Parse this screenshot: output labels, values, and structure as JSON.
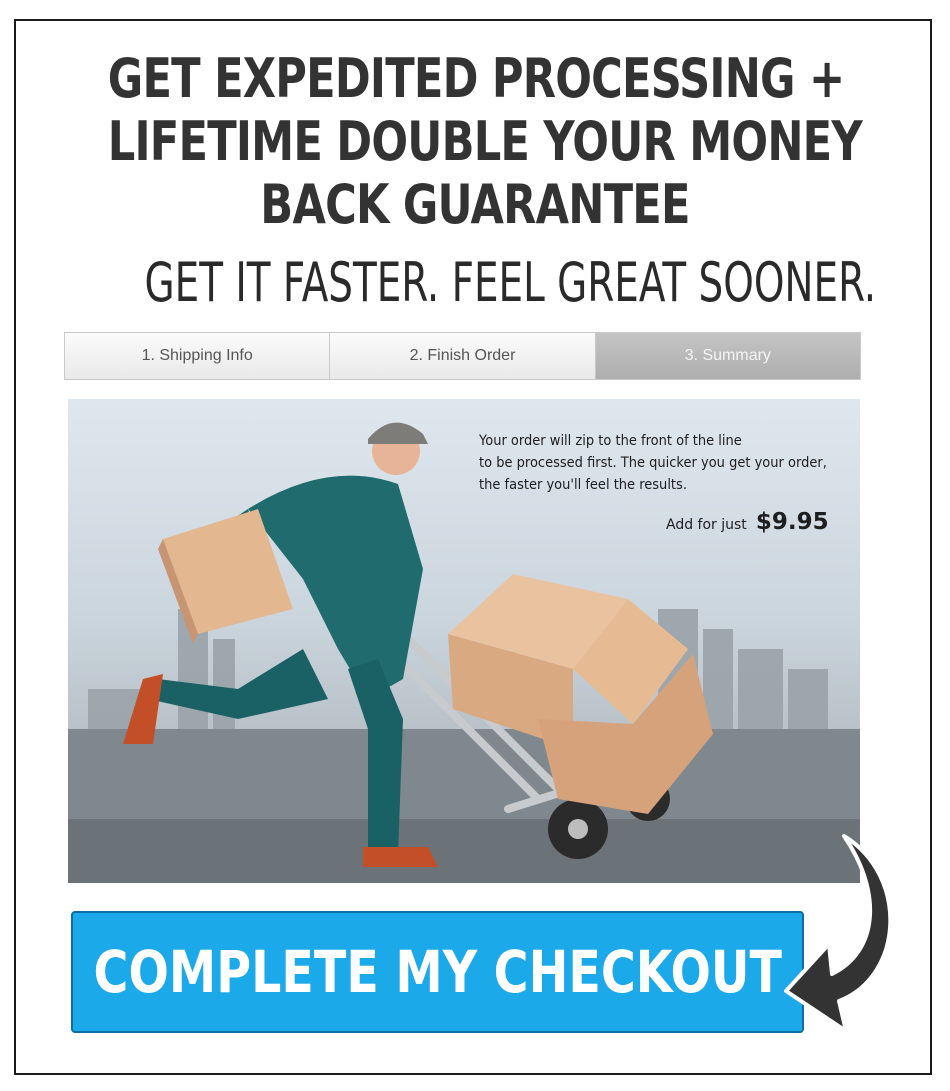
{
  "headline": {
    "line1": "GET EXPEDITED PROCESSING +",
    "line2": "LIFETIME DOUBLE YOUR MONEY",
    "line3": "BACK GUARANTEE"
  },
  "subheadline": "GET IT FASTER. FEEL GREAT SOONER.",
  "steps": [
    {
      "label": "1. Shipping Info",
      "active": false
    },
    {
      "label": "2. Finish Order",
      "active": false
    },
    {
      "label": "3. Summary",
      "active": true
    }
  ],
  "offer": {
    "line1": "Your order will zip to the front of the line",
    "line2": "to be processed first. The quicker you get your order,",
    "line3": "the faster you'll feel the results.",
    "price_prefix": "Add for just",
    "price": "$9.95"
  },
  "cta": {
    "label": "COMPLETE MY CHECKOUT",
    "color": "#1ba9ea"
  },
  "icons": {
    "arrow": "curved-arrow-icon",
    "hero": "delivery-man-hand-truck-image"
  }
}
